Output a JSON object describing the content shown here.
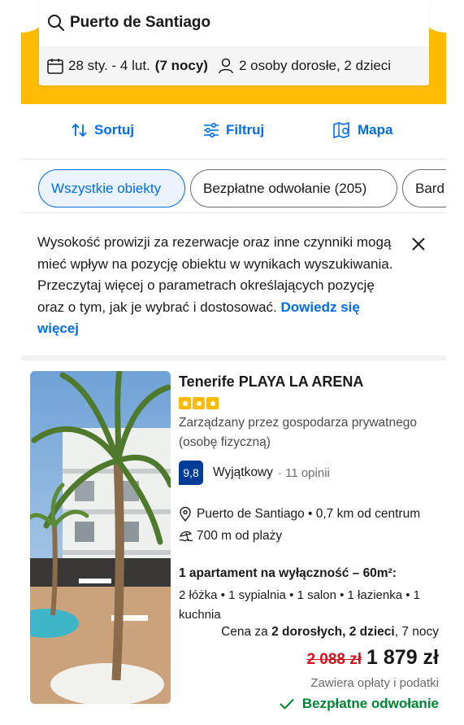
{
  "search": {
    "destination": "Puerto de Santiago",
    "dates": "28 sty. - 4 lut.",
    "nights": "(7 nocy)",
    "guests": "2 osoby dorosłe, 2 dzieci"
  },
  "toolbar": {
    "sort_label": "Sortuj",
    "filter_label": "Filtruj",
    "map_label": "Mapa"
  },
  "chips": [
    {
      "label": "Wszystkie obiekty"
    },
    {
      "label": "Bezpłatne odwołanie (205)"
    },
    {
      "label": "Bard"
    }
  ],
  "notice": {
    "text": "Wysokość prowizji za rezerwacje oraz inne czynniki mogą mieć wpływ na pozycję obiektu w wynikach wyszukiwania. Przeczytaj więcej o parametrach określających pozycję oraz o tym, jak je wybrać i dostosować.",
    "link": "Dowiedz się więcej"
  },
  "listing": {
    "name": "Tenerife PLAYA LA ARENA",
    "stars": 3,
    "managed_by": "Zarządzany przez gospodarza prywatnego (osobę fizyczną)",
    "score": "9,8",
    "rating_word": "Wyjątkowy",
    "reviews": "· 11 opinii",
    "location": "Puerto de Santiago • 0,7 km od centrum",
    "beach": "700 m od plaży",
    "unit_title": "1 apartament na wyłączność – 60m²:",
    "unit_desc": "2 łóżka • 1 sypialnia • 1 salon • 1 łazienka • 1 kuchnia",
    "price_for_prefix": "Cena za ",
    "price_for_bold": "2 dorosłych, 2 dzieci",
    "price_for_suffix": ", 7 nocy",
    "old_price": "2 088 zł",
    "new_price": "1 879 zł",
    "taxes": "Zawiera opłaty i podatki",
    "free_cancellation": "Bezpłatne odwołanie"
  },
  "colors": {
    "brand_yellow": "#febb02",
    "link_blue": "#006ce4",
    "score_blue": "#003b95",
    "price_red": "#d4111e",
    "success_green": "#008234"
  }
}
